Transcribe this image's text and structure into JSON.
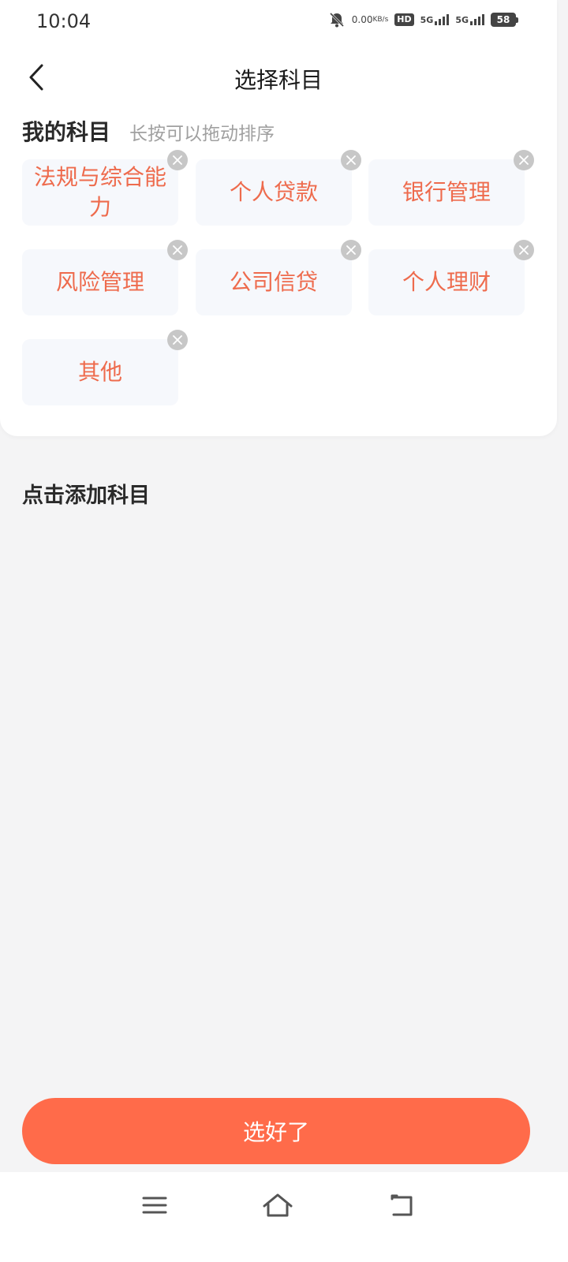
{
  "status_bar": {
    "time": "10:04",
    "net_speed_value": "0.00",
    "net_speed_unit": "KB/s",
    "hd_label": "HD",
    "sim1_label": "5G",
    "sim2_label": "5G",
    "battery": "58"
  },
  "header": {
    "title": "选择科目",
    "back_icon": "chevron-left-icon"
  },
  "my_subjects": {
    "title": "我的科目",
    "hint": "长按可以拖动排序",
    "items": [
      {
        "label": "法规与综合能力"
      },
      {
        "label": "个人贷款"
      },
      {
        "label": "银行管理"
      },
      {
        "label": "风险管理"
      },
      {
        "label": "公司信贷"
      },
      {
        "label": "个人理财"
      },
      {
        "label": "其他"
      }
    ]
  },
  "add_section": {
    "title": "点击添加科目"
  },
  "confirm_button": {
    "label": "选好了"
  },
  "nav_bar": {
    "menu_icon": "menu-icon",
    "home_icon": "home-icon",
    "back_icon": "back-icon"
  },
  "colors": {
    "accent": "#ff6b4a",
    "chip_text": "#ee6b4d",
    "chip_bg": "#f6f8fc",
    "page_bg": "#f4f4f5"
  }
}
